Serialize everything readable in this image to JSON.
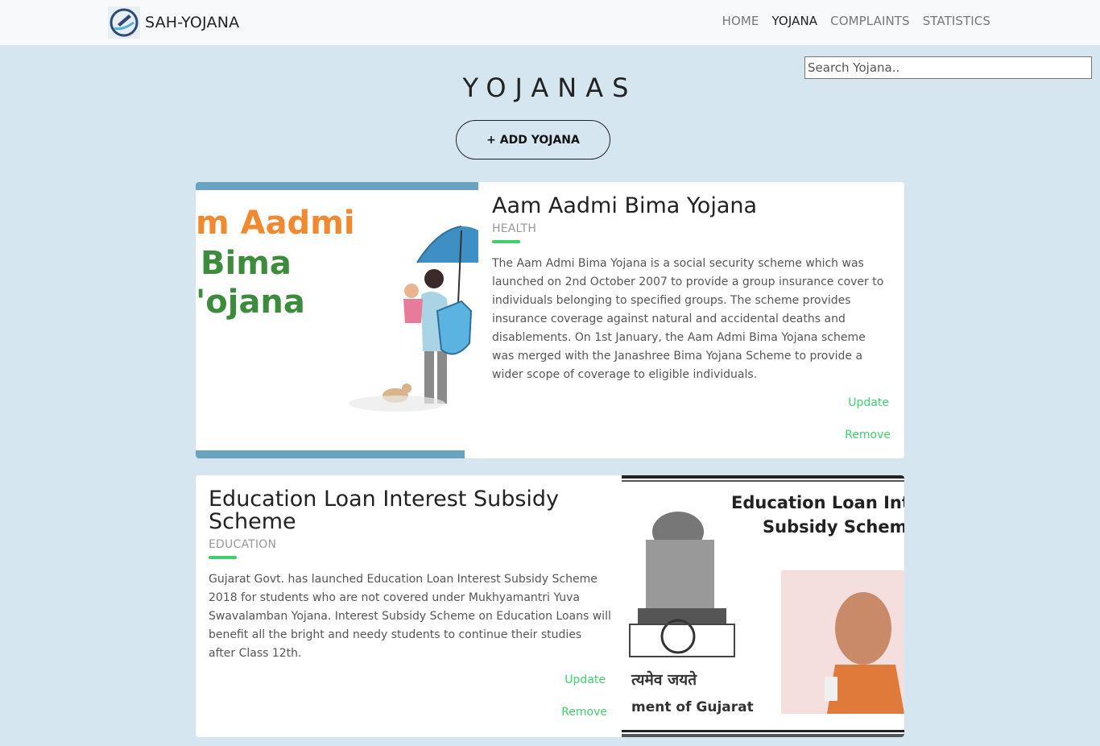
{
  "navbar": {
    "brand": "SAH-YOJANA",
    "links": [
      "HOME",
      "YOJANA",
      "COMPLAINTS",
      "STATISTICS"
    ]
  },
  "search": {
    "placeholder": "Search Yojana.."
  },
  "page": {
    "title": "YOJANAS",
    "add_button": "+ ADD YOJANA"
  },
  "yojanas": [
    {
      "title": "Aam Aadmi Bima Yojana",
      "category": "HEALTH",
      "description": "The Aam Admi Bima Yojana is a social security scheme which was launched on 2nd October 2007 to provide a group insurance cover to individuals belonging to specified groups. The scheme provides insurance coverage against natural and accidental deaths and disablements. On 1st January, the Aam Admi Bima Yojana scheme was merged with the Janashree Bima Yojana Scheme to provide a wider scope of coverage to eligible individuals.",
      "update_label": "Update",
      "remove_label": "Remove",
      "image_text": [
        "m Aadmi",
        "Bima",
        "'ojana"
      ]
    },
    {
      "title": "Education Loan Interest Subsidy Scheme",
      "category": "EDUCATION",
      "description": "Gujarat Govt. has launched Education Loan Interest Subsidy Scheme 2018 for students who are not covered under Mukhyamantri Yuva Swavalamban Yojana. Interest Subsidy Scheme on Education Loans will benefit all the bright and needy students to continue their studies after Class 12th.",
      "update_label": "Update",
      "remove_label": "Remove",
      "image_text": [
        "Education Loan Inter",
        "Subsidy Scheme",
        "त्यमेव जयते",
        "ment of Gujarat"
      ]
    }
  ],
  "colors": {
    "background": "#d6e6f1",
    "accent_green": "#3ecf6d",
    "navbar_bg": "#f8f9fa",
    "image_frame_blue": "#6aa3c0",
    "illustration_orange": "#f0892f",
    "illustration_green": "#3d8b3d"
  }
}
